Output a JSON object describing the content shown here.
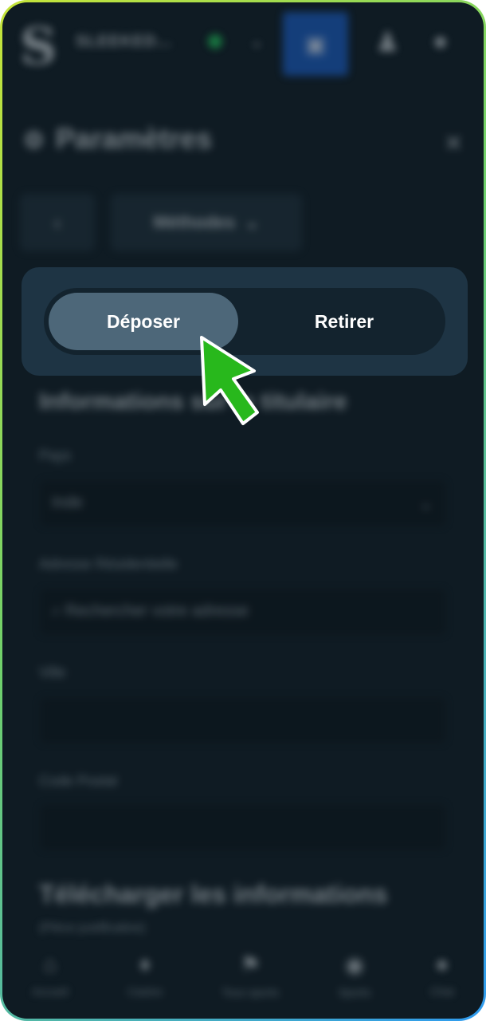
{
  "header": {
    "logo": "S",
    "account_name": "SLEEKED...",
    "wallet_icon": "wallet-icon",
    "profile_icon": "profile-icon",
    "chat_icon": "chat-icon"
  },
  "settings": {
    "title": "Paramètres",
    "back_label": "‹",
    "filter_label": "Méthodes"
  },
  "switcher": {
    "tabs": [
      {
        "label": "Déposer",
        "active": true
      },
      {
        "label": "Retirer",
        "active": false
      }
    ]
  },
  "form": {
    "section_title": "Informations sur le titulaire",
    "fields": [
      {
        "label": "Pays",
        "value": "Inde"
      },
      {
        "label": "Adresse Résidentielle",
        "value": "Rechercher votre adresse"
      },
      {
        "label": "Ville",
        "value": ""
      },
      {
        "label": "Code Postal",
        "value": ""
      }
    ]
  },
  "upload": {
    "title": "Télécharger les informations",
    "subtitle": "(Pièce justificative)"
  },
  "bottom_nav": {
    "items": [
      {
        "label": "Accueil",
        "icon": "home-icon"
      },
      {
        "label": "Casino",
        "icon": "casino-icon"
      },
      {
        "label": "Tous sports",
        "icon": "sports-icon"
      },
      {
        "label": "Sports",
        "icon": "ball-icon"
      },
      {
        "label": "Chat",
        "icon": "chat-icon"
      }
    ]
  },
  "colors": {
    "background": "#0f1b23",
    "panel": "#1e3444",
    "active_tab": "#4d6779",
    "wallet_blue": "#1a5cc4",
    "cursor_green": "#28b81c",
    "border_gradient": [
      "#c6e43a",
      "#6fd06c",
      "#2f9bf0"
    ]
  }
}
